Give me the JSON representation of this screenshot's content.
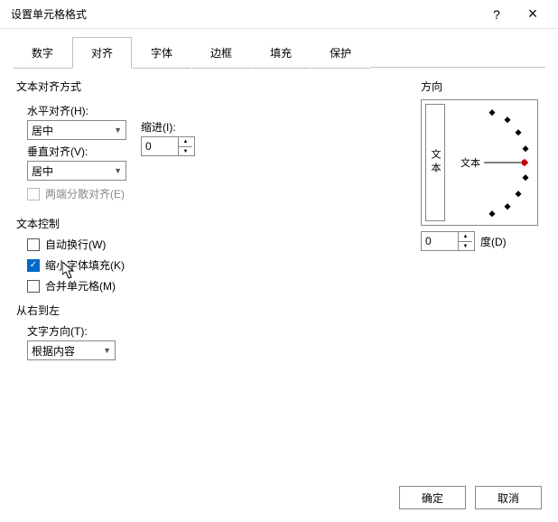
{
  "window": {
    "title": "设置单元格格式",
    "help": "?",
    "close": "×"
  },
  "tabs": [
    {
      "label": "数字",
      "active": false
    },
    {
      "label": "对齐",
      "active": true
    },
    {
      "label": "字体",
      "active": false
    },
    {
      "label": "边框",
      "active": false
    },
    {
      "label": "填充",
      "active": false
    },
    {
      "label": "保护",
      "active": false
    }
  ],
  "text_alignment": {
    "group_label": "文本对齐方式",
    "horizontal_label": "水平对齐(H):",
    "horizontal_value": "居中",
    "indent_label": "缩进(I):",
    "indent_value": "0",
    "vertical_label": "垂直对齐(V):",
    "vertical_value": "居中",
    "justify_distributed_label": "两端分散对齐(E)",
    "justify_distributed_checked": false,
    "justify_distributed_enabled": false
  },
  "text_control": {
    "group_label": "文本控制",
    "wrap_label": "自动换行(W)",
    "wrap_checked": false,
    "shrink_label": "缩小字体填充(K)",
    "shrink_checked": true,
    "merge_label": "合并单元格(M)",
    "merge_checked": false
  },
  "right_to_left": {
    "group_label": "从右到左",
    "direction_label": "文字方向(T):",
    "direction_value": "根据内容"
  },
  "orientation": {
    "group_label": "方向",
    "vertical_text": "文本",
    "dial_text": "文本",
    "degrees_value": "0",
    "degrees_label": "度(D)"
  },
  "buttons": {
    "ok": "确定",
    "cancel": "取消"
  }
}
